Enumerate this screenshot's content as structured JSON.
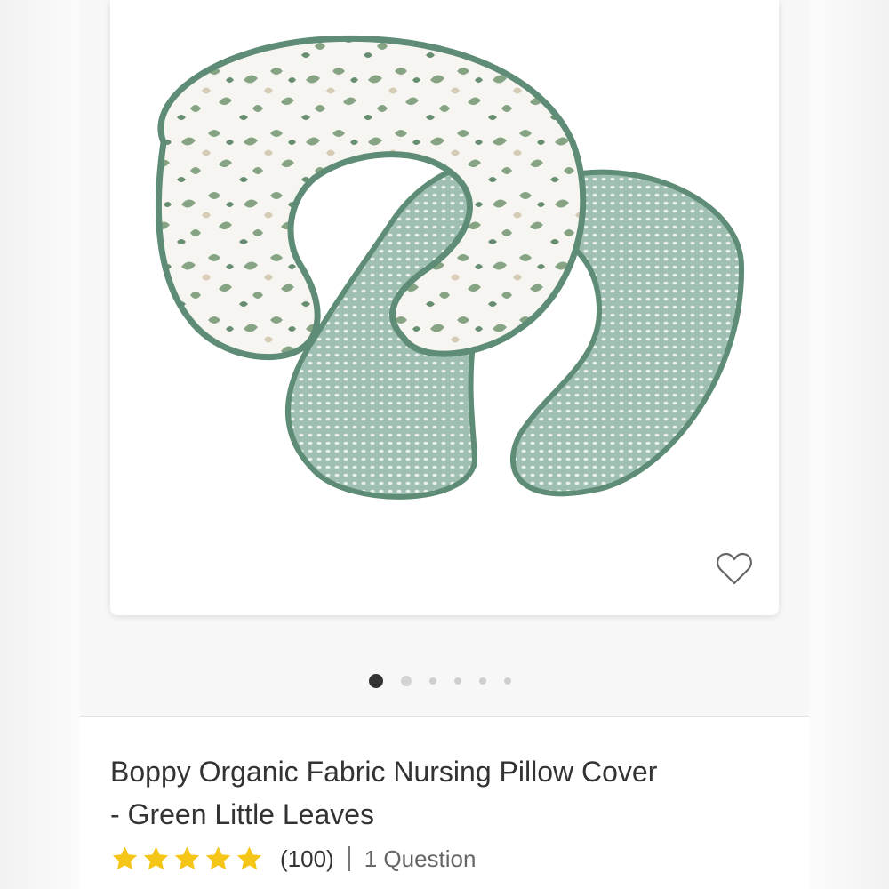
{
  "product": {
    "title_line1": "Boppy Organic Fabric Nursing Pillow Cover",
    "title_line2": "- Green Little Leaves",
    "rating": 5,
    "rating_max": 5,
    "review_count": "(100)",
    "questions": "1 Question"
  },
  "gallery": {
    "image_count": 6,
    "active_index": 0
  },
  "icons": {
    "favorite": "heart-outline-icon",
    "star": "star-icon"
  },
  "colors": {
    "star": "#F5C518",
    "active_dot": "#333333",
    "inactive_dot": "#D0D0D0",
    "piping": "#5E8C76",
    "leaf": "#6E9A72"
  }
}
